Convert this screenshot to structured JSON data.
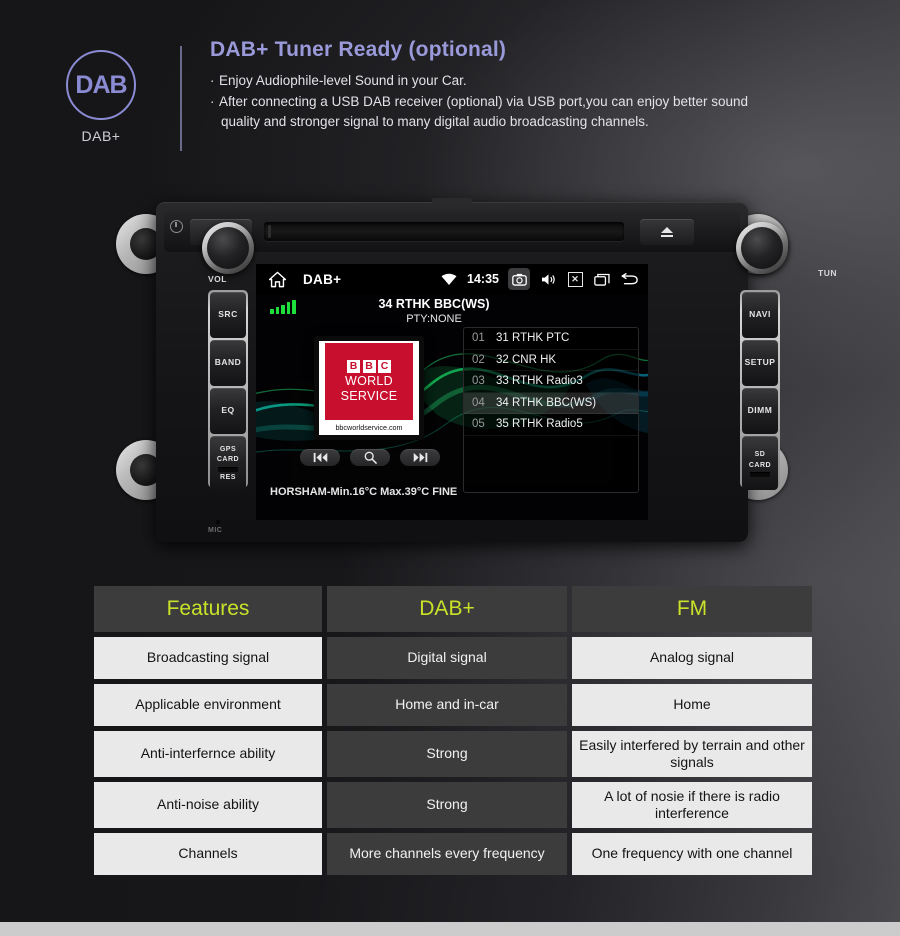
{
  "header": {
    "logo_text": "DAB",
    "logo_caption": "DAB+",
    "title": "DAB+ Tuner Ready (optional)",
    "bullet1": "Enjoy Audiophile-level Sound in your Car.",
    "bullet2": "After connecting a USB DAB receiver (optional) via USB port,you can enjoy better sound",
    "bullet2_cont": "quality and stronger signal to many digital audio broadcasting channels.",
    "accent_color": "#9a9ada",
    "bullet_marker": "·"
  },
  "unit": {
    "knob_left_label": "VOL",
    "knob_right_label": "TUN",
    "left_buttons": [
      "SRC",
      "BAND",
      "EQ"
    ],
    "left_card_line1": "GPS",
    "left_card_line2": "CARD",
    "left_card_line3": "RES",
    "right_buttons": [
      "NAVI",
      "SETUP",
      "DIMM"
    ],
    "right_card_line1": "SD",
    "right_card_line2": "CARD",
    "mic_label": "MIC"
  },
  "screen": {
    "source_label": "DAB+",
    "clock": "14:35",
    "signal_bars": 5,
    "signal_color": "#1ee03c",
    "now_playing": "34 RTHK BBC(WS)",
    "pty": "PTY:NONE",
    "weather": "HORSHAM-Min.16°C Max.39°C FINE",
    "album_art": {
      "bbc_letters": [
        "B",
        "B",
        "C"
      ],
      "line1": "WORLD",
      "line2": "SERVICE",
      "url": "bbcworldservice.com",
      "brand_color": "#c8102e"
    },
    "presets": [
      {
        "num": "01",
        "name": "31 RTHK PTC",
        "selected": false
      },
      {
        "num": "02",
        "name": "32 CNR HK",
        "selected": false
      },
      {
        "num": "03",
        "name": "33 RTHK Radio3",
        "selected": false
      },
      {
        "num": "04",
        "name": "34 RTHK BBC(WS)",
        "selected": true
      },
      {
        "num": "05",
        "name": "35 RTHK Radio5",
        "selected": false
      }
    ],
    "status_icons": [
      "wifi-icon",
      "camera-icon",
      "volume-icon",
      "close-box-icon",
      "recent-apps-icon",
      "back-icon"
    ],
    "controls": [
      "previous-track-icon",
      "search-icon",
      "next-track-icon"
    ]
  },
  "table": {
    "accent_color": "#c9e229",
    "headers": [
      "Features",
      "DAB+",
      "FM"
    ],
    "rows": [
      {
        "feature": "Broadcasting signal",
        "dab": "Digital signal",
        "fm": "Analog signal"
      },
      {
        "feature": "Applicable environment",
        "dab": "Home and in-car",
        "fm": "Home"
      },
      {
        "feature": "Anti-interfernce ability",
        "dab": "Strong",
        "fm": "Easily interfered by terrain and other signals"
      },
      {
        "feature": "Anti-noise ability",
        "dab": "Strong",
        "fm": "A lot of nosie if there is radio interference"
      },
      {
        "feature": "Channels",
        "dab": "More channels every frequency",
        "fm": "One frequency with one channel"
      }
    ]
  }
}
